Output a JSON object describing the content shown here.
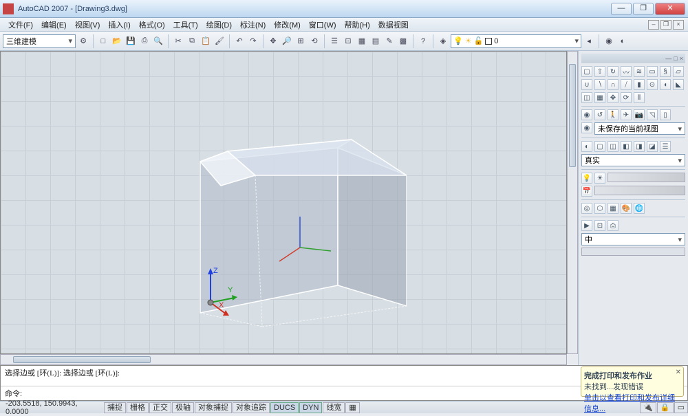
{
  "title": "AutoCAD 2007 - [Drawing3.dwg]",
  "menus": [
    "文件(F)",
    "编辑(E)",
    "视图(V)",
    "插入(I)",
    "格式(O)",
    "工具(T)",
    "绘图(D)",
    "标注(N)",
    "修改(M)",
    "窗口(W)",
    "帮助(H)",
    "数据视图"
  ],
  "workspace": "三维建模",
  "layer_current": "0",
  "view_saved": "未保存的当前视图",
  "visual_style": "真实",
  "subd_level": "中",
  "cmd_history": "选择边或 [环(L)]: 选择边或 [环(L)]:",
  "cmd_prompt": "命令:",
  "coord": "-203.5518, 150.9943, 0.0000",
  "status_buttons": [
    "捕捉",
    "栅格",
    "正交",
    "极轴",
    "对象捕捉",
    "对象追踪",
    "DUCS",
    "DYN",
    "线宽"
  ],
  "notif_line1": "完成打印和发布作业",
  "notif_line2": "未找到...发现错误",
  "notif_link": "单击以查看打印和发布详细信息..."
}
